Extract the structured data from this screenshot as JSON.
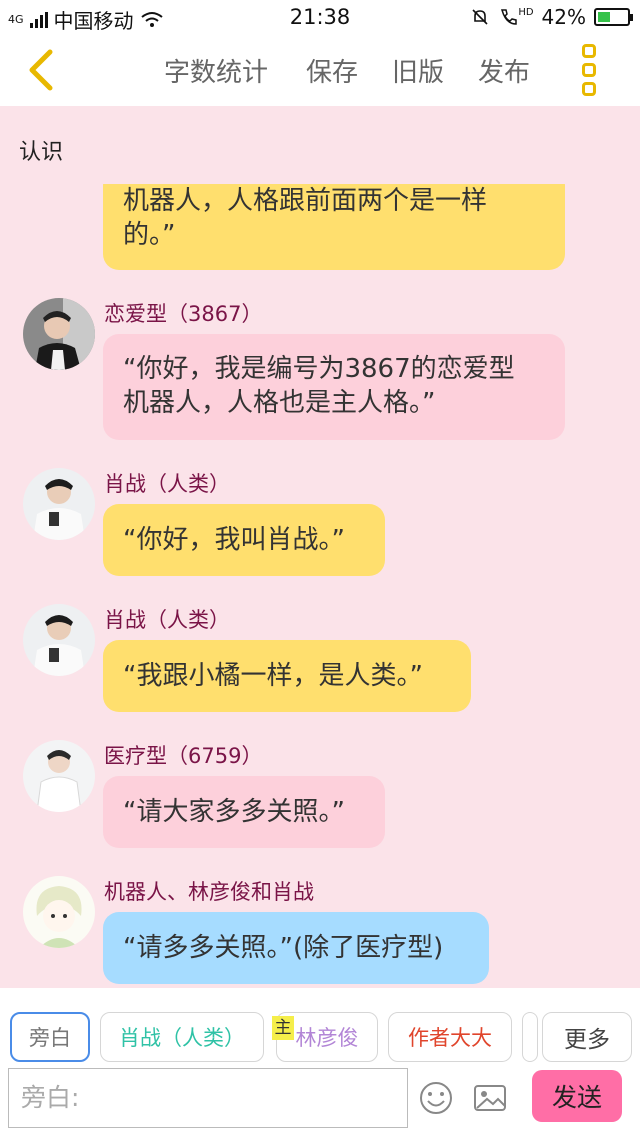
{
  "status_bar": {
    "network": "4G",
    "carrier": "中国移动",
    "time": "21:38",
    "hd": "HD",
    "battery": "42%",
    "battery_level": 0.42
  },
  "toolbar": {
    "word_count": "字数统计",
    "save": "保存",
    "old_version": "旧版",
    "publish": "发布"
  },
  "chapter": {
    "title": "认识"
  },
  "messages": [
    {
      "speaker": "",
      "text_lines": [
        "机器人，人格跟前面两个是一样",
        "的。”"
      ]
    },
    {
      "speaker": "恋爱型（3867）",
      "text_lines": [
        "“你好，我是编号为3867的恋爱型",
        "机器人，人格也是主人格。”"
      ]
    },
    {
      "speaker": "肖战（人类）",
      "text_lines": [
        "“你好，我叫肖战。”"
      ]
    },
    {
      "speaker": "肖战（人类）",
      "text_lines": [
        "“我跟小橘一样，是人类。”"
      ]
    },
    {
      "speaker": "医疗型（6759）",
      "text_lines": [
        "“请大家多多关照。”"
      ]
    },
    {
      "speaker": "机器人、林彦俊和肖战",
      "text_lines": [
        "“请多多关照。”(除了医疗型)"
      ]
    }
  ],
  "characters": {
    "narration": "旁白",
    "xiao_zhan": "肖战（人类）",
    "main_badge": "主",
    "lin_yanjun": "林彦俊",
    "author": "作者大大",
    "more": "更多"
  },
  "input": {
    "placeholder": "旁白:"
  },
  "send_label": "发送",
  "colors": {
    "page_bg": "#fbe3e9",
    "bubble_yellow": "#ffdf6e",
    "bubble_pink": "#fdd0db",
    "bubble_blue": "#a6dcff",
    "speaker_name": "#7a1447",
    "accent_yellow": "#e8b800",
    "send_button": "#ff6ea6"
  }
}
